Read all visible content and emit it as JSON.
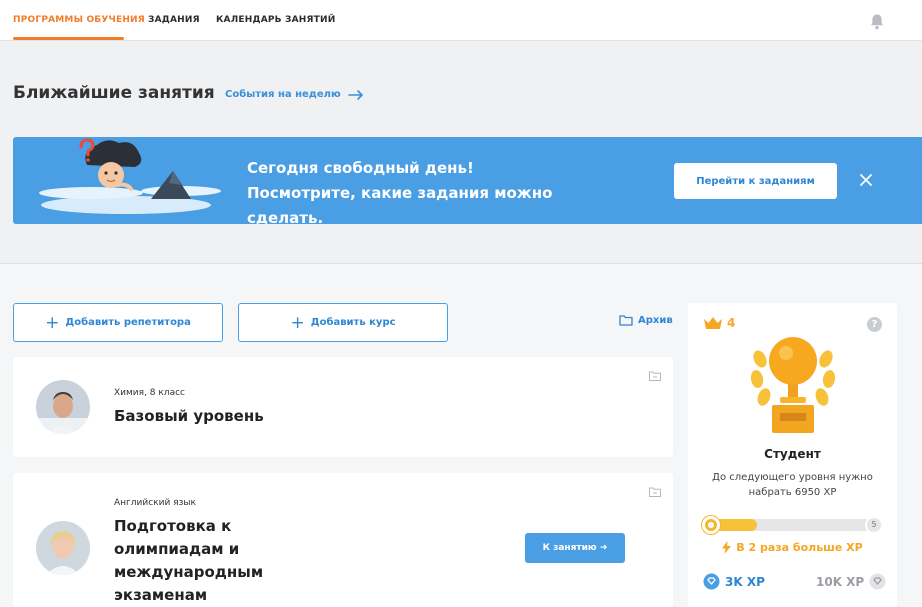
{
  "nav": {
    "tabs": [
      {
        "label": "ПРОГРАММЫ ОБУЧЕНИЯ",
        "active": true
      },
      {
        "label": "ЗАДАНИЯ",
        "active": false
      },
      {
        "label": "КАЛЕНДАРЬ ЗАНЯТИЙ",
        "active": false
      }
    ],
    "notifications_icon": "bell-icon"
  },
  "upcoming": {
    "title": "Ближайшие занятия",
    "week_link": "События на неделю",
    "banner": {
      "message": "Сегодня свободный день! Посмотрите, какие задания можно сделать.",
      "button": "Перейти к заданиям"
    }
  },
  "actions": {
    "add_tutor": "Добавить репетитора",
    "add_course": "Добавить курс",
    "archive": "Архив"
  },
  "courses": [
    {
      "subject": "Химия, 8 класс",
      "name": "Базовый уровень",
      "button": ""
    },
    {
      "subject": "Английский язык",
      "name": "Подготовка к олимпиадам и международным экзаменам",
      "button": "К занятию ➜"
    }
  ],
  "level": {
    "crowns": "4",
    "help": "?",
    "name": "Студент",
    "hint": "До следующего уровня нужно набрать 6950 XP",
    "next_level": "5",
    "progress": 0.3,
    "boost": "В 2 раза больше XP",
    "xp_current": "3K XP",
    "xp_target": "10K XP"
  },
  "colors": {
    "accent": "#f07d2a",
    "primary": "#4a9ee3",
    "gold": "#f5a623"
  }
}
